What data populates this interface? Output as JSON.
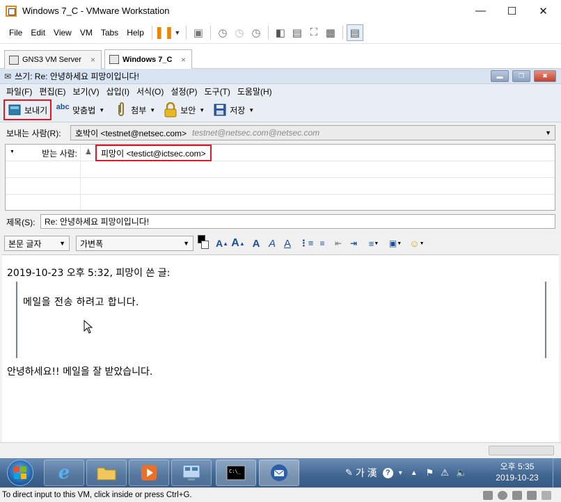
{
  "vmware": {
    "window_title": "Windows 7_C - VMware Workstation",
    "menu": [
      "File",
      "Edit",
      "View",
      "VM",
      "Tabs",
      "Help"
    ],
    "tabs": [
      {
        "label": "GNS3 VM Server",
        "close": "×"
      },
      {
        "label": "Windows 7_C",
        "close": "×"
      }
    ],
    "status_hint": "To direct input to this VM, click inside or press Ctrl+G."
  },
  "compose": {
    "window_title": "쓰기: Re: 안녕하세요 피망이입니다!",
    "menu": [
      "파일(F)",
      "편집(E)",
      "보기(V)",
      "삽입(I)",
      "서식(O)",
      "설정(P)",
      "도구(T)",
      "도움말(H)"
    ],
    "toolbar": {
      "send": "보내기",
      "spell": "맞춤법",
      "attach": "첨부",
      "security": "보안",
      "save": "저장",
      "spell_icon_text": "abc"
    },
    "from_label": "보내는 사람(R):",
    "from_value": "호박이 <testnet@netsec.com>",
    "from_identity": "testnet@netsec.com@netsec.com",
    "recipient_type": "받는 사람:",
    "recipient_value": "피망이 <testict@ictsec.com>",
    "subject_label": "제목(S):",
    "subject_value": "Re: 안녕하세요 피망이입니다!",
    "format": {
      "style": "본문 글자",
      "font": "가변폭"
    },
    "body": {
      "quote_header": "2019-10-23 오후 5:32, 피망이 쓴 글:",
      "quoted": "메일을 전송 하려고 합니다.",
      "reply": "안녕하세요!! 메일을 잘 받았습니다."
    }
  },
  "taskbar": {
    "ime": "가 漢",
    "clock_time": "오후 5:35",
    "clock_date": "2019-10-23"
  },
  "colors": {
    "highlight_box": "#e2182a",
    "quote_bar": "#6f7fa6"
  }
}
